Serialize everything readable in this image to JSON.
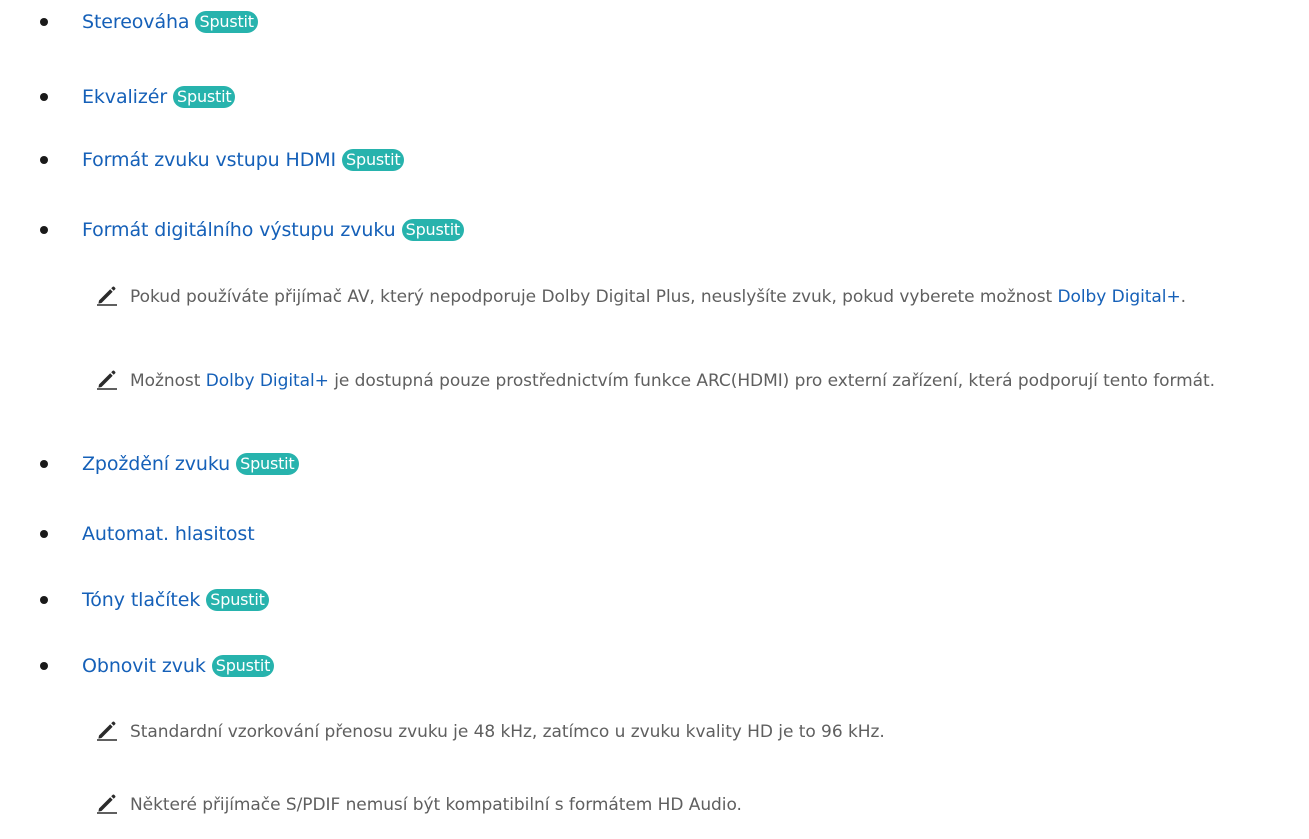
{
  "list": {
    "items": [
      {
        "label": "Stereováha",
        "action": "Spustit"
      },
      {
        "label": "Ekvalizér",
        "action": "Spustit"
      },
      {
        "label": "Formát zvuku vstupu HDMI",
        "action": "Spustit"
      },
      {
        "label": "Formát digitálního výstupu zvuku",
        "action": "Spustit"
      },
      {
        "label": "Zpoždění zvuku",
        "action": "Spustit"
      },
      {
        "label": "Automat. hlasitost"
      },
      {
        "label": "Tóny tlačítek",
        "action": "Spustit"
      },
      {
        "label": "Obnovit zvuk",
        "action": "Spustit"
      }
    ]
  },
  "notes": {
    "digital_1": {
      "before": "Pokud používáte přijímač AV, který nepodporuje Dolby Digital Plus, neuslyšíte zvuk, pokud vyberete možnost ",
      "link": "Dolby Digital+",
      "after": "."
    },
    "digital_2": {
      "before": "Možnost ",
      "link": "Dolby Digital+",
      "after": " je dostupná pouze prostřednictvím funkce ARC(HDMI) pro externí zařízení, která podporují tento formát."
    },
    "reset_1": {
      "text": "Standardní vzorkování přenosu zvuku je 48 kHz, zatímco u zvuku kvality HD je to 96 kHz."
    },
    "reset_2": {
      "text": "Některé přijímače S/PDIF nemusí být kompatibilní s formátem HD Audio."
    }
  },
  "icons": {
    "note": "pencil-icon"
  },
  "colors": {
    "link": "#1560b8",
    "badge": "#27b3ad",
    "note_text": "#5f5f5f",
    "bullet": "#1a1a1a"
  }
}
